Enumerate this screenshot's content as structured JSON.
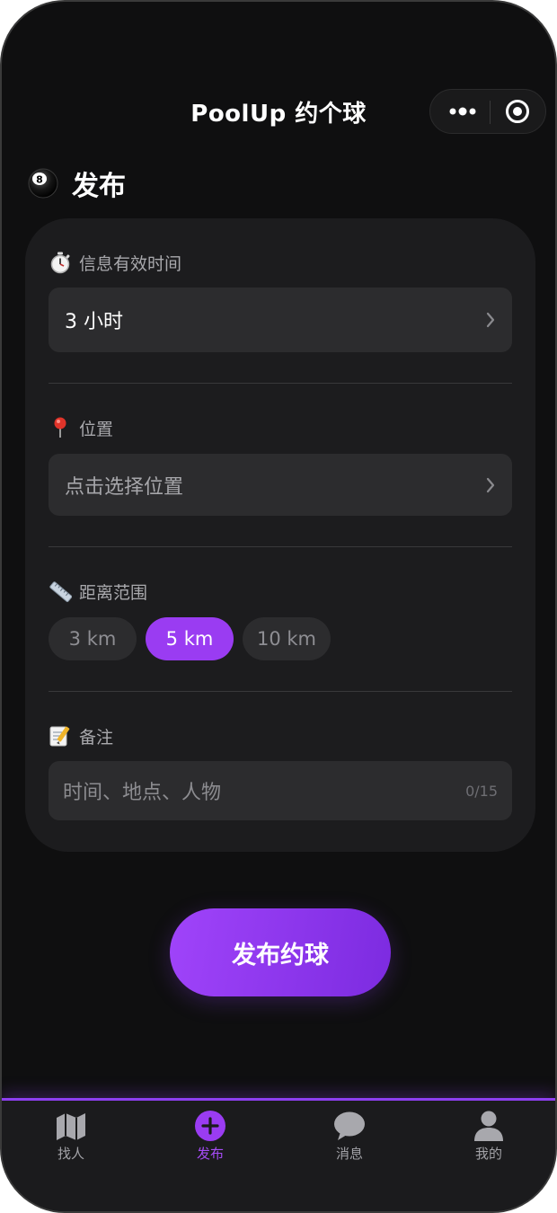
{
  "header": {
    "app_title": "PoolUp 约个球",
    "menu_icon": "more-dots-icon",
    "close_icon": "target-icon"
  },
  "section": {
    "icon": "8-ball-icon",
    "title": "发布"
  },
  "form": {
    "duration": {
      "icon": "stopwatch-icon",
      "label": "信息有效时间",
      "value": "3 小时"
    },
    "location": {
      "icon": "pin-icon",
      "label": "位置",
      "placeholder": "点击选择位置"
    },
    "distance": {
      "icon": "ruler-icon",
      "label": "距离范围",
      "options": [
        "3 km",
        "5 km",
        "10 km"
      ],
      "selected": "5 km"
    },
    "note": {
      "icon": "memo-icon",
      "label": "备注",
      "placeholder": "时间、地点、人物",
      "counter": "0/15"
    }
  },
  "submit_label": "发布约球",
  "tabbar": {
    "tabs": [
      {
        "label": "找人",
        "icon": "map-icon"
      },
      {
        "label": "发布",
        "icon": "plus-circle-icon"
      },
      {
        "label": "消息",
        "icon": "chat-bubble-icon"
      },
      {
        "label": "我的",
        "icon": "user-icon"
      }
    ],
    "active": "发布"
  },
  "colors": {
    "accent": "#9a3cf2",
    "background": "#0f0f10",
    "card": "#1c1c1e",
    "field": "#2c2c2e"
  }
}
